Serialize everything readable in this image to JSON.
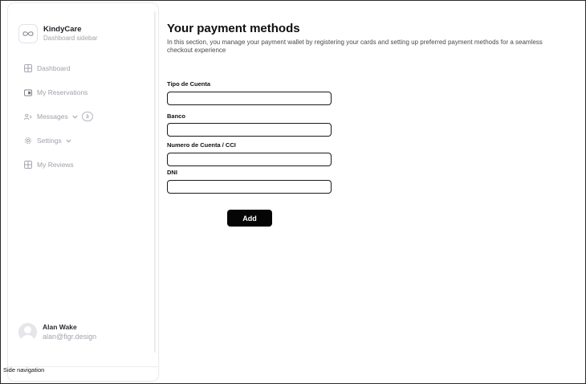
{
  "sidebar": {
    "brand": {
      "name": "KindyCare",
      "subtitle": "Dashboard sidebar",
      "logo_icon": "infinity-icon"
    },
    "items": [
      {
        "label": "Dashboard",
        "icon": "grid-icon"
      },
      {
        "label": "My Reservations",
        "icon": "calendar-card-icon"
      },
      {
        "label": "Messages",
        "icon": "users-icon",
        "badge": "3",
        "has_chevron": true
      },
      {
        "label": "Settings",
        "icon": "gear-icon",
        "has_chevron": true
      },
      {
        "label": "My Reviews",
        "icon": "grid-icon"
      }
    ],
    "user": {
      "name": "Alan Wake",
      "email": "alan@figr.design"
    },
    "caption": "Side navigation"
  },
  "main": {
    "title": "Your payment methods",
    "description": "In this section, you manage your payment wallet by registering your cards and setting up preferred payment methods for a seamless checkout experience",
    "fields": [
      {
        "label": "Tipo de Cuenta",
        "value": "",
        "placeholder": ""
      },
      {
        "label": "Banco",
        "value": "",
        "placeholder": ""
      },
      {
        "label": "Numero de Cuenta / CCI",
        "value": "",
        "placeholder": ""
      },
      {
        "label": "DNI",
        "value": "",
        "placeholder": ""
      }
    ],
    "add_label": "Add"
  },
  "colors": {
    "accent": "#050505",
    "muted_text": "#a0a0ab",
    "border": "#1a1a1a"
  }
}
